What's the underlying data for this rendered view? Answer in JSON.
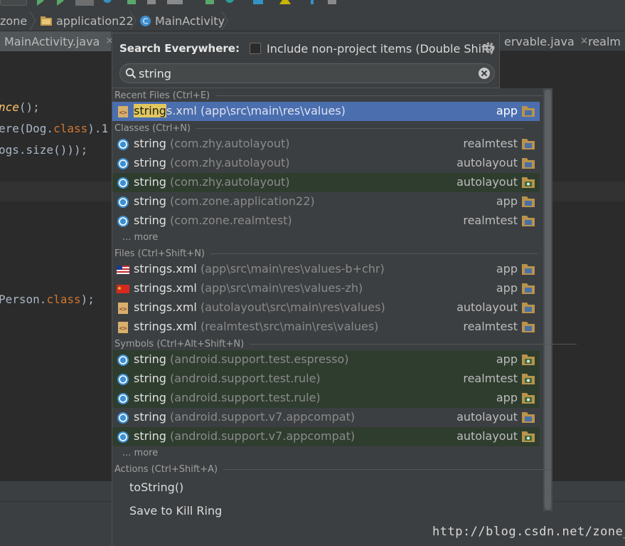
{
  "breadcrumb": [
    {
      "label": "zone",
      "icon": "folder-icon"
    },
    {
      "label": "application22",
      "icon": "folder-icon"
    },
    {
      "label": "MainActivity",
      "icon": "class-icon"
    }
  ],
  "tabs": {
    "left": {
      "label": "MainActivity.java"
    },
    "right1": {
      "label": "ervable.java"
    },
    "right2": {
      "label": "realm"
    }
  },
  "code_lines": [
    {
      "a": "nce",
      "b": "();"
    },
    {
      "a": "ere(Dog.",
      "b": "class",
      "c": ").1"
    },
    {
      "a": "ogs.size()));"
    },
    {
      "a": "Person.",
      "b": "class",
      "c": ");"
    }
  ],
  "popup": {
    "title": "Search Everywhere:",
    "include_label": "Include non-project items (Double Shift)",
    "include_checked": false,
    "query": "string"
  },
  "groups": {
    "recent": {
      "header": "Recent Files (Ctrl+E)",
      "items": [
        {
          "name_hl": "string",
          "name_rest": "s.xml",
          "path": "(app\\src\\main\\res\\values)",
          "module": "app"
        }
      ]
    },
    "classes": {
      "header": "Classes (Ctrl+N)",
      "items": [
        {
          "name": "string",
          "path": "(com.zhy.autolayout)",
          "module": "realmtest"
        },
        {
          "name": "string",
          "path": "(com.zhy.autolayout)",
          "module": "autolayout"
        },
        {
          "name": "string",
          "path": "(com.zhy.autolayout)",
          "module": "autolayout"
        },
        {
          "name": "string",
          "path": "(com.zone.application22)",
          "module": "app"
        },
        {
          "name": "string",
          "path": "(com.zone.realmtest)",
          "module": "realmtest"
        }
      ],
      "more": "... more"
    },
    "files": {
      "header": "Files (Ctrl+Shift+N)",
      "items": [
        {
          "name": "strings.xml",
          "path": "(app\\src\\main\\res\\values-b+chr)",
          "module": "app"
        },
        {
          "name": "strings.xml",
          "path": "(app\\src\\main\\res\\values-zh)",
          "module": "app"
        },
        {
          "name": "strings.xml",
          "path": "(autolayout\\src\\main\\res\\values)",
          "module": "autolayout"
        },
        {
          "name": "strings.xml",
          "path": "(realmtest\\src\\main\\res\\values)",
          "module": "realmtest"
        }
      ]
    },
    "symbols": {
      "header": "Symbols (Ctrl+Alt+Shift+N)",
      "items": [
        {
          "name": "string",
          "path": "(android.support.test.espresso)",
          "module": "app"
        },
        {
          "name": "string",
          "path": "(android.support.test.rule)",
          "module": "realmtest"
        },
        {
          "name": "string",
          "path": "(android.support.test.rule)",
          "module": "app"
        },
        {
          "name": "string",
          "path": "(android.support.v7.appcompat)",
          "module": "autolayout"
        },
        {
          "name": "string",
          "path": "(android.support.v7.appcompat)",
          "module": "autolayout"
        }
      ],
      "more": "... more"
    },
    "actions": {
      "header": "Actions (Ctrl+Shift+A)",
      "items": [
        {
          "label": "toString()"
        },
        {
          "label": "Save to Kill Ring"
        }
      ]
    }
  },
  "watermark": "http://blog.csdn.net/zone_",
  "colors": {
    "selected_row": "#4b6eaf",
    "library_row": "#2f3d2f",
    "highlight": "#e2c75d"
  }
}
